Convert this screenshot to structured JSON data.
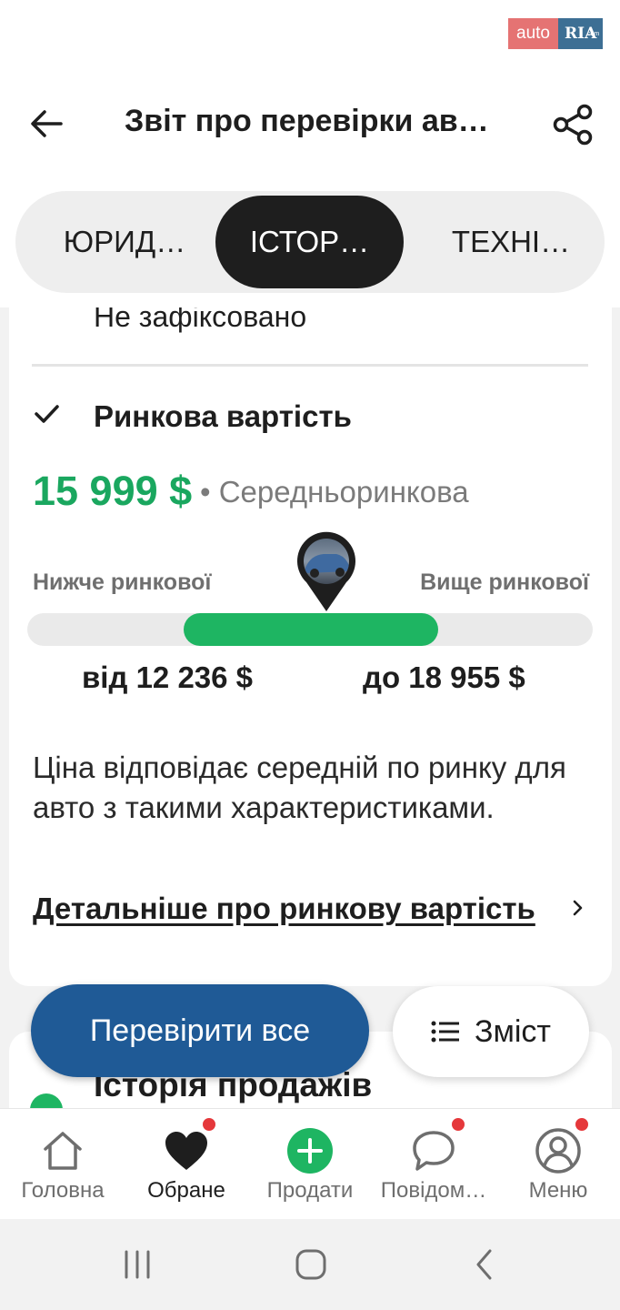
{
  "logo": {
    "auto": "auto",
    "ria": "RIA",
    "domain": ".com"
  },
  "header": {
    "title": "Звіт про перевірки ав…"
  },
  "tabs": [
    {
      "label": "ЮРИД…",
      "active": false
    },
    {
      "label": "ІСТОР…",
      "active": true
    },
    {
      "label": "ТЕХНІ…",
      "active": false
    }
  ],
  "prev_section": {
    "status_text": "Не зафіксовано"
  },
  "market_value": {
    "title": "Ринкова вартість",
    "price": "15 999 $",
    "price_label": "• Середньоринкова",
    "lower_label": "Нижче ринкової",
    "upper_label": "Вище ринкової",
    "range_from": "від 12 236 $",
    "range_to": "до 18 955 $",
    "range_min": 12236,
    "range_max": 18955,
    "price_value": 15999,
    "description": "Ціна відповідає середній по ринку для авто з такими характеристиками.",
    "detail_link": "Детальніше про ринкову вартість"
  },
  "next_section": {
    "title": "Історія продажів"
  },
  "actions": {
    "check_all": "Перевірити все",
    "contents": "Зміст"
  },
  "bottom_nav": [
    {
      "label": "Головна",
      "icon": "home-icon",
      "badge": false,
      "active": false
    },
    {
      "label": "Обране",
      "icon": "heart-icon",
      "badge": true,
      "active": true
    },
    {
      "label": "Продати",
      "icon": "plus-circle-icon",
      "badge": false,
      "active": false
    },
    {
      "label": "Повідом…",
      "icon": "chat-icon",
      "badge": true,
      "active": false
    },
    {
      "label": "Меню",
      "icon": "profile-icon",
      "badge": true,
      "active": false
    }
  ],
  "colors": {
    "accent_green": "#1eb562",
    "primary_blue": "#1f5a96",
    "badge_red": "#e5383b"
  }
}
